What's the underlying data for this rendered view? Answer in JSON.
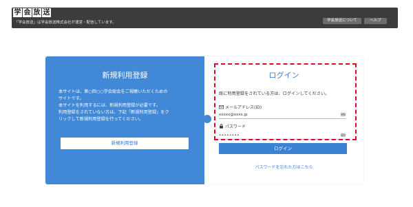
{
  "header": {
    "logo_chars": [
      "学",
      "会",
      "放",
      "送"
    ],
    "tagline": "「学会放送」は学会放送株式会社が運営・配信しています。",
    "about_button": "学会放送について",
    "help_button": "ヘルプ"
  },
  "register": {
    "title": "新規利用登録",
    "description_lines": [
      "本サイトは、第○回○○学会総会をご視聴いただくための",
      "サイトです。",
      "本サイトを利用するには、新規利用登録が必要です。",
      "利用登録をされていない方は、下記「新規利用登録」をク",
      "リックして新規利用登録を行ってください。"
    ],
    "button": "新規利用登録"
  },
  "login": {
    "title": "ログイン",
    "message": "既に利用登録をされている方は、ログインしてください。",
    "email_label": "メールアドレス(ID)",
    "email_value": "xxxxx@xxxx.jp",
    "password_label": "パスワード",
    "password_value": "••••••••",
    "button": "ログイン",
    "forgot_link": "パスワードを忘れた方はこちら"
  },
  "colors": {
    "header_bg": "#3c3c3c",
    "register_panel": "#4189d7",
    "accent_blue": "#3b82d2",
    "highlight_red": "#e0002a"
  },
  "icons": [
    "envelope-icon",
    "lock-icon",
    "keyboard-icon"
  ]
}
